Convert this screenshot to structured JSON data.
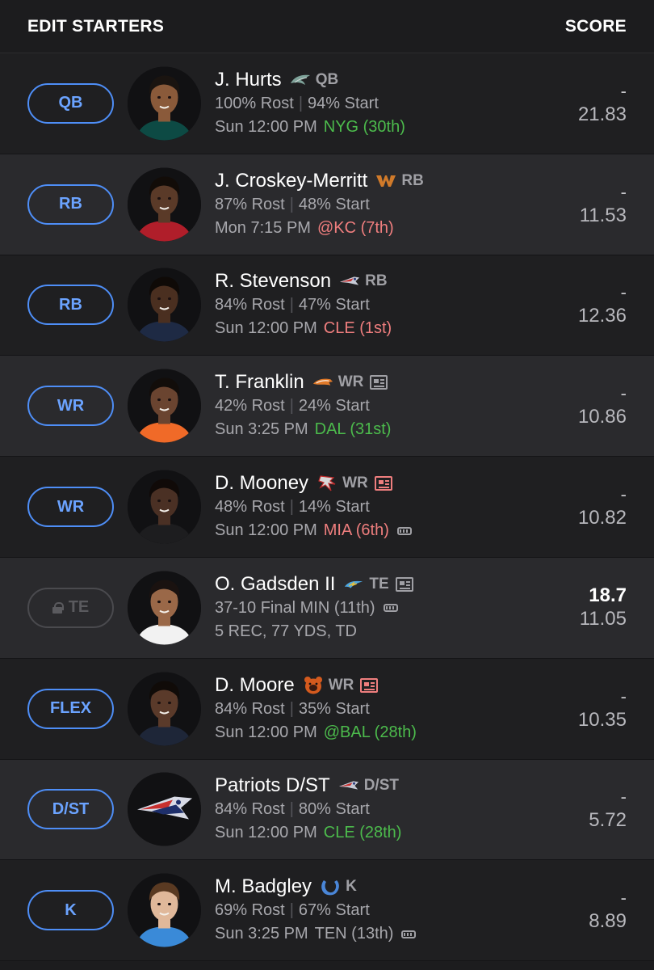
{
  "header": {
    "title": "EDIT STARTERS",
    "score_label": "SCORE"
  },
  "rows": [
    {
      "slot": "QB",
      "name": "J. Hurts",
      "team": "eagles",
      "pos": "QB",
      "news": null,
      "rost": "100% Rost",
      "start": "94% Start",
      "time": "Sun 12:00 PM",
      "opp": "NYG (30th)",
      "opp_tone": "good",
      "weather": false,
      "actual": "-",
      "proj": "21.83"
    },
    {
      "slot": "RB",
      "name": "J. Croskey-Merritt",
      "team": "commanders",
      "pos": "RB",
      "news": null,
      "rost": "87% Rost",
      "start": "48% Start",
      "time": "Mon 7:15 PM",
      "opp": "@KC (7th)",
      "opp_tone": "bad",
      "weather": false,
      "actual": "-",
      "proj": "11.53"
    },
    {
      "slot": "RB",
      "name": "R. Stevenson",
      "team": "patriots",
      "pos": "RB",
      "news": null,
      "rost": "84% Rost",
      "start": "47% Start",
      "time": "Sun 12:00 PM",
      "opp": "CLE (1st)",
      "opp_tone": "bad",
      "weather": false,
      "actual": "-",
      "proj": "12.36"
    },
    {
      "slot": "WR",
      "name": "T. Franklin",
      "team": "broncos",
      "pos": "WR",
      "news": "normal",
      "rost": "42% Rost",
      "start": "24% Start",
      "time": "Sun 3:25 PM",
      "opp": "DAL (31st)",
      "opp_tone": "good",
      "weather": false,
      "actual": "-",
      "proj": "10.86"
    },
    {
      "slot": "WR",
      "name": "D. Mooney",
      "team": "falcons",
      "pos": "WR",
      "news": "hot",
      "rost": "48% Rost",
      "start": "14% Start",
      "time": "Sun 12:00 PM",
      "opp": "MIA (6th)",
      "opp_tone": "bad",
      "weather": true,
      "actual": "-",
      "proj": "10.82"
    },
    {
      "slot": "TE",
      "locked": true,
      "name": "O. Gadsden II",
      "team": "chargers",
      "pos": "TE",
      "news": "normal",
      "line2": "37-10 Final MIN (11th)",
      "line3": "5 REC, 77 YDS, TD",
      "weather": true,
      "actual": "18.7",
      "proj": "11.05"
    },
    {
      "slot": "FLEX",
      "name": "D. Moore",
      "team": "bears",
      "pos": "WR",
      "news": "hot",
      "rost": "84% Rost",
      "start": "35% Start",
      "time": "Sun 12:00 PM",
      "opp": "@BAL (28th)",
      "opp_tone": "good",
      "weather": false,
      "actual": "-",
      "proj": "10.35"
    },
    {
      "slot": "D/ST",
      "name": "Patriots D/ST",
      "team": "patriots",
      "pos": "D/ST",
      "news": null,
      "rost": "84% Rost",
      "start": "80% Start",
      "time": "Sun 12:00 PM",
      "opp": "CLE (28th)",
      "opp_tone": "good",
      "weather": false,
      "actual": "-",
      "proj": "5.72"
    },
    {
      "slot": "K",
      "name": "M. Badgley",
      "team": "colts",
      "pos": "K",
      "news": null,
      "rost": "69% Rost",
      "start": "67% Start",
      "time": "Sun 3:25 PM",
      "opp": "TEN (13th)",
      "opp_tone": "neutral",
      "weather": true,
      "actual": "-",
      "proj": "8.89"
    }
  ],
  "colors": {
    "slot_border": "#4e8ef7",
    "good": "#4cbb4c",
    "bad": "#ef7e7e"
  }
}
